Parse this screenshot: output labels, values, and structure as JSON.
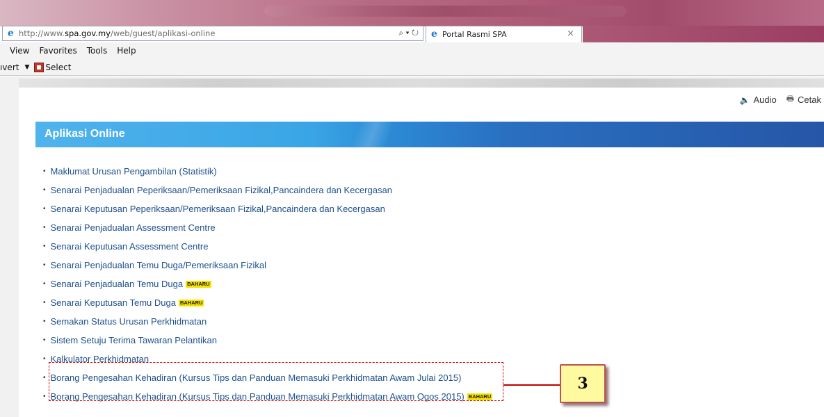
{
  "browser": {
    "url_prefix": "http://www.",
    "url_domain": "spa.gov.my",
    "url_path": "/web/guest/aplikasi-online",
    "search_icon": "⌕ ▾",
    "refresh_icon": "↻",
    "tab_title": "Portal Rasmi SPA",
    "tab_close": "×"
  },
  "menu": [
    "View",
    "Favorites",
    "Tools",
    "Help"
  ],
  "command_bar": {
    "convert_label": "ıvert",
    "dropdown_glyph": "▼",
    "select_label": "Select"
  },
  "tools": {
    "audio_label": "Audio",
    "print_label": "Cetak"
  },
  "section": {
    "title": "Aplikasi Online"
  },
  "badge_text": "BAHARU",
  "links": [
    {
      "label": "Maklumat Urusan Pengambilan (Statistik)",
      "badge": false
    },
    {
      "label": "Senarai Penjadualan Peperiksaan/Pemeriksaan Fizikal,Pancaindera dan Kecergasan",
      "badge": false
    },
    {
      "label": "Senarai Keputusan Peperiksaan/Pemeriksaan Fizikal,Pancaindera dan Kecergasan",
      "badge": false
    },
    {
      "label": "Senarai Penjadualan Assessment Centre",
      "badge": false
    },
    {
      "label": "Senarai Keputusan Assessment Centre",
      "badge": false
    },
    {
      "label": "Senarai Penjadualan Temu Duga/Pemeriksaan Fizikal",
      "badge": false
    },
    {
      "label": "Senarai Penjadualan Temu Duga",
      "badge": true
    },
    {
      "label": "Senarai Keputusan Temu Duga",
      "badge": true
    },
    {
      "label": "Semakan Status Urusan Perkhidmatan",
      "badge": false
    },
    {
      "label": "Sistem Setuju Terima Tawaran Pelantikan",
      "badge": false
    },
    {
      "label": "Kalkulator Perkhidmatan",
      "badge": false
    },
    {
      "label": "Borang Pengesahan Kehadiran (Kursus Tips dan Panduan Memasuki Perkhidmatan Awam Julai 2015)",
      "badge": false
    },
    {
      "label": "Borang Pengesahan Kehadiran (Kursus Tips dan Panduan Memasuki Perkhidmatan Awam Ogos 2015)",
      "badge": true
    }
  ],
  "annotation": {
    "number": "3",
    "color": "#c00000"
  }
}
